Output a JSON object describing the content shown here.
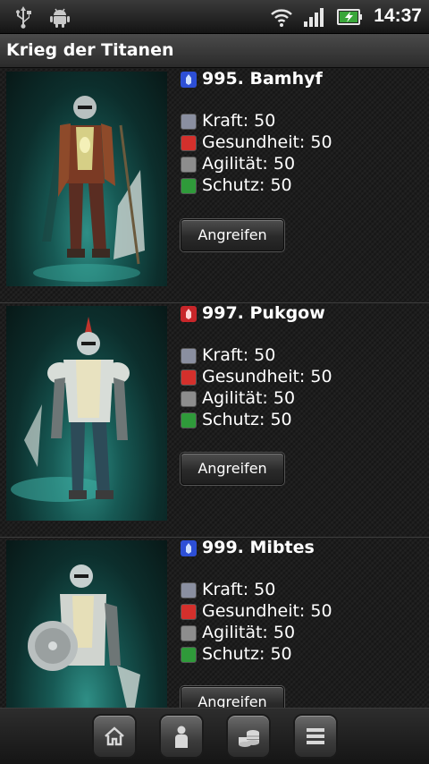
{
  "status_bar": {
    "time": "14:37",
    "icons": [
      "usb-icon",
      "android-debug-icon",
      "wifi-icon",
      "signal-icon",
      "battery-charging-icon"
    ]
  },
  "app": {
    "title": "Krieg der Titanen"
  },
  "enemies": [
    {
      "name": "995. Bamhyf",
      "faction_color": "#2d4fd6",
      "stats": [
        "Kraft: 50",
        "Gesundheit: 50",
        "Agilität: 50",
        "Schutz: 50"
      ],
      "attack_label": "Angreifen"
    },
    {
      "name": "997. Pukgow",
      "faction_color": "#c8262a",
      "stats": [
        "Kraft: 50",
        "Gesundheit: 50",
        "Agilität: 50",
        "Schutz: 50"
      ],
      "attack_label": "Angreifen"
    },
    {
      "name": "999. Mibtes",
      "faction_color": "#2d4fd6",
      "stats": [
        "Kraft: 50",
        "Gesundheit: 50",
        "Agilität: 50",
        "Schutz: 50"
      ],
      "attack_label": "Angreifen"
    }
  ],
  "stat_icons": [
    "fist-icon",
    "heart-icon",
    "agility-icon",
    "shield-icon"
  ],
  "stat_colors": [
    "#8a8fa0",
    "#d3302c",
    "#8d8d8d",
    "#2f9a3a"
  ],
  "bottom_nav": [
    "home-icon",
    "profile-icon",
    "coins-icon",
    "menu-icon"
  ]
}
